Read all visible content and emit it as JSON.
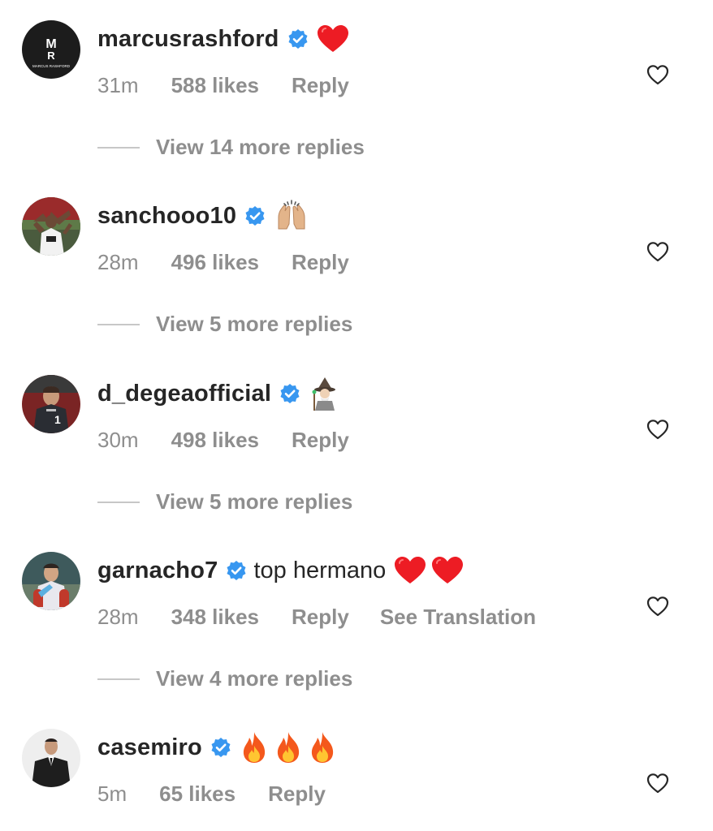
{
  "comments": [
    {
      "username": "marcusrashford",
      "verified": true,
      "text": "",
      "emoji": [
        "red-heart"
      ],
      "time": "31m",
      "likes": "588 likes",
      "reply_label": "Reply",
      "translate_label": "",
      "view_replies": "View 14 more replies",
      "avatar_text": "MARCUS RASHFORD"
    },
    {
      "username": "sanchooo10",
      "verified": true,
      "text": "",
      "emoji": [
        "raising-hands"
      ],
      "time": "28m",
      "likes": "496 likes",
      "reply_label": "Reply",
      "translate_label": "",
      "view_replies": "View 5 more replies"
    },
    {
      "username": "d_degeaofficial",
      "verified": true,
      "text": "",
      "emoji": [
        "mage"
      ],
      "time": "30m",
      "likes": "498 likes",
      "reply_label": "Reply",
      "translate_label": "",
      "view_replies": "View 5 more replies"
    },
    {
      "username": "garnacho7",
      "verified": true,
      "text": "top hermano",
      "emoji": [
        "red-heart",
        "red-heart"
      ],
      "time": "28m",
      "likes": "348 likes",
      "reply_label": "Reply",
      "translate_label": "See Translation",
      "view_replies": "View 4 more replies"
    },
    {
      "username": "casemiro",
      "verified": true,
      "text": "",
      "emoji": [
        "fire",
        "fire",
        "fire"
      ],
      "time": "5m",
      "likes": "65 likes",
      "reply_label": "Reply",
      "translate_label": "",
      "view_replies": ""
    }
  ],
  "colors": {
    "primary_text": "#262626",
    "secondary_text": "#8e8e8e",
    "verified_blue": "#3897f0",
    "heart_red": "#ed1c24"
  }
}
